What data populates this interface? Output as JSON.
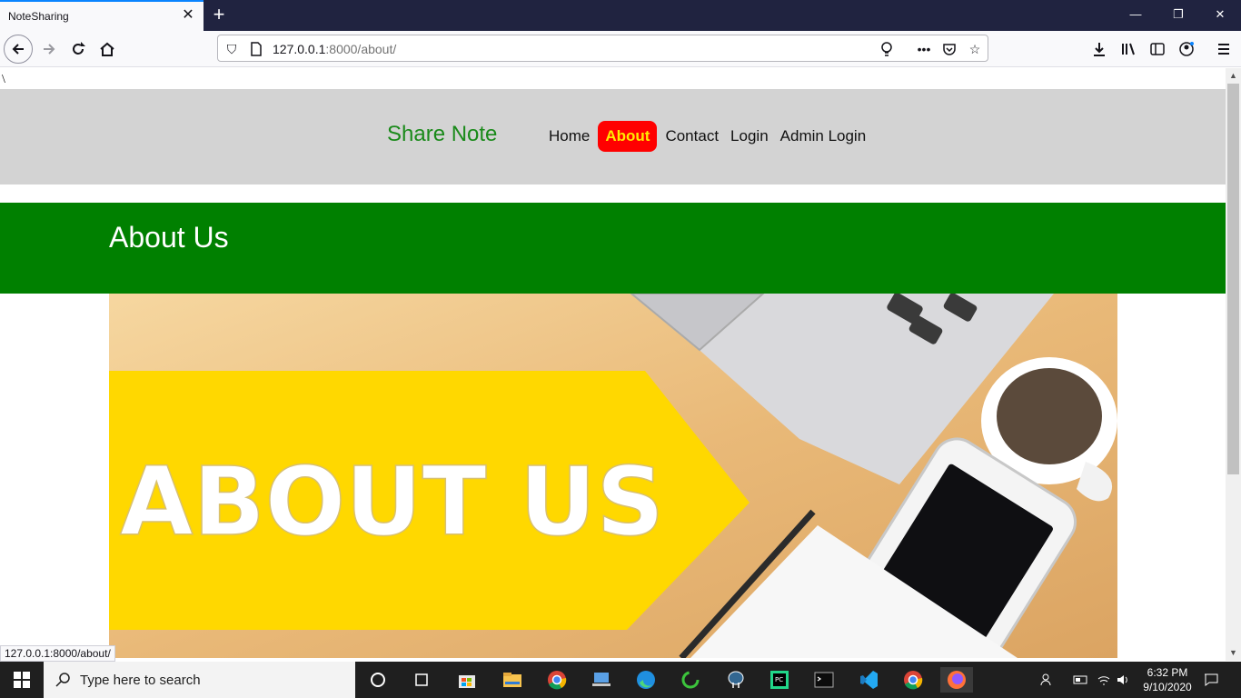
{
  "browser": {
    "tab_title": "NoteSharing",
    "url_host": "127.0.0.1",
    "url_rest": ":8000/about/",
    "status_url": "127.0.0.1:8000/about/"
  },
  "page": {
    "stray_char": "\\",
    "brand": "Share Note",
    "menu": [
      {
        "label": "Home",
        "active": false
      },
      {
        "label": "About",
        "active": true
      },
      {
        "label": "Contact",
        "active": false
      },
      {
        "label": "Login",
        "active": false
      },
      {
        "label": "Admin Login",
        "active": false
      }
    ],
    "banner_title": "About Us",
    "hero_text": "ABOUT US"
  },
  "taskbar": {
    "search_placeholder": "Type here to search",
    "time": "6:32 PM",
    "date": "9/10/2020"
  },
  "colors": {
    "header_bg": "#d3d3d3",
    "brand": "#1a8a1a",
    "active_bg": "#ff0000",
    "active_text": "#ffeb00",
    "banner_bg": "#008000"
  }
}
